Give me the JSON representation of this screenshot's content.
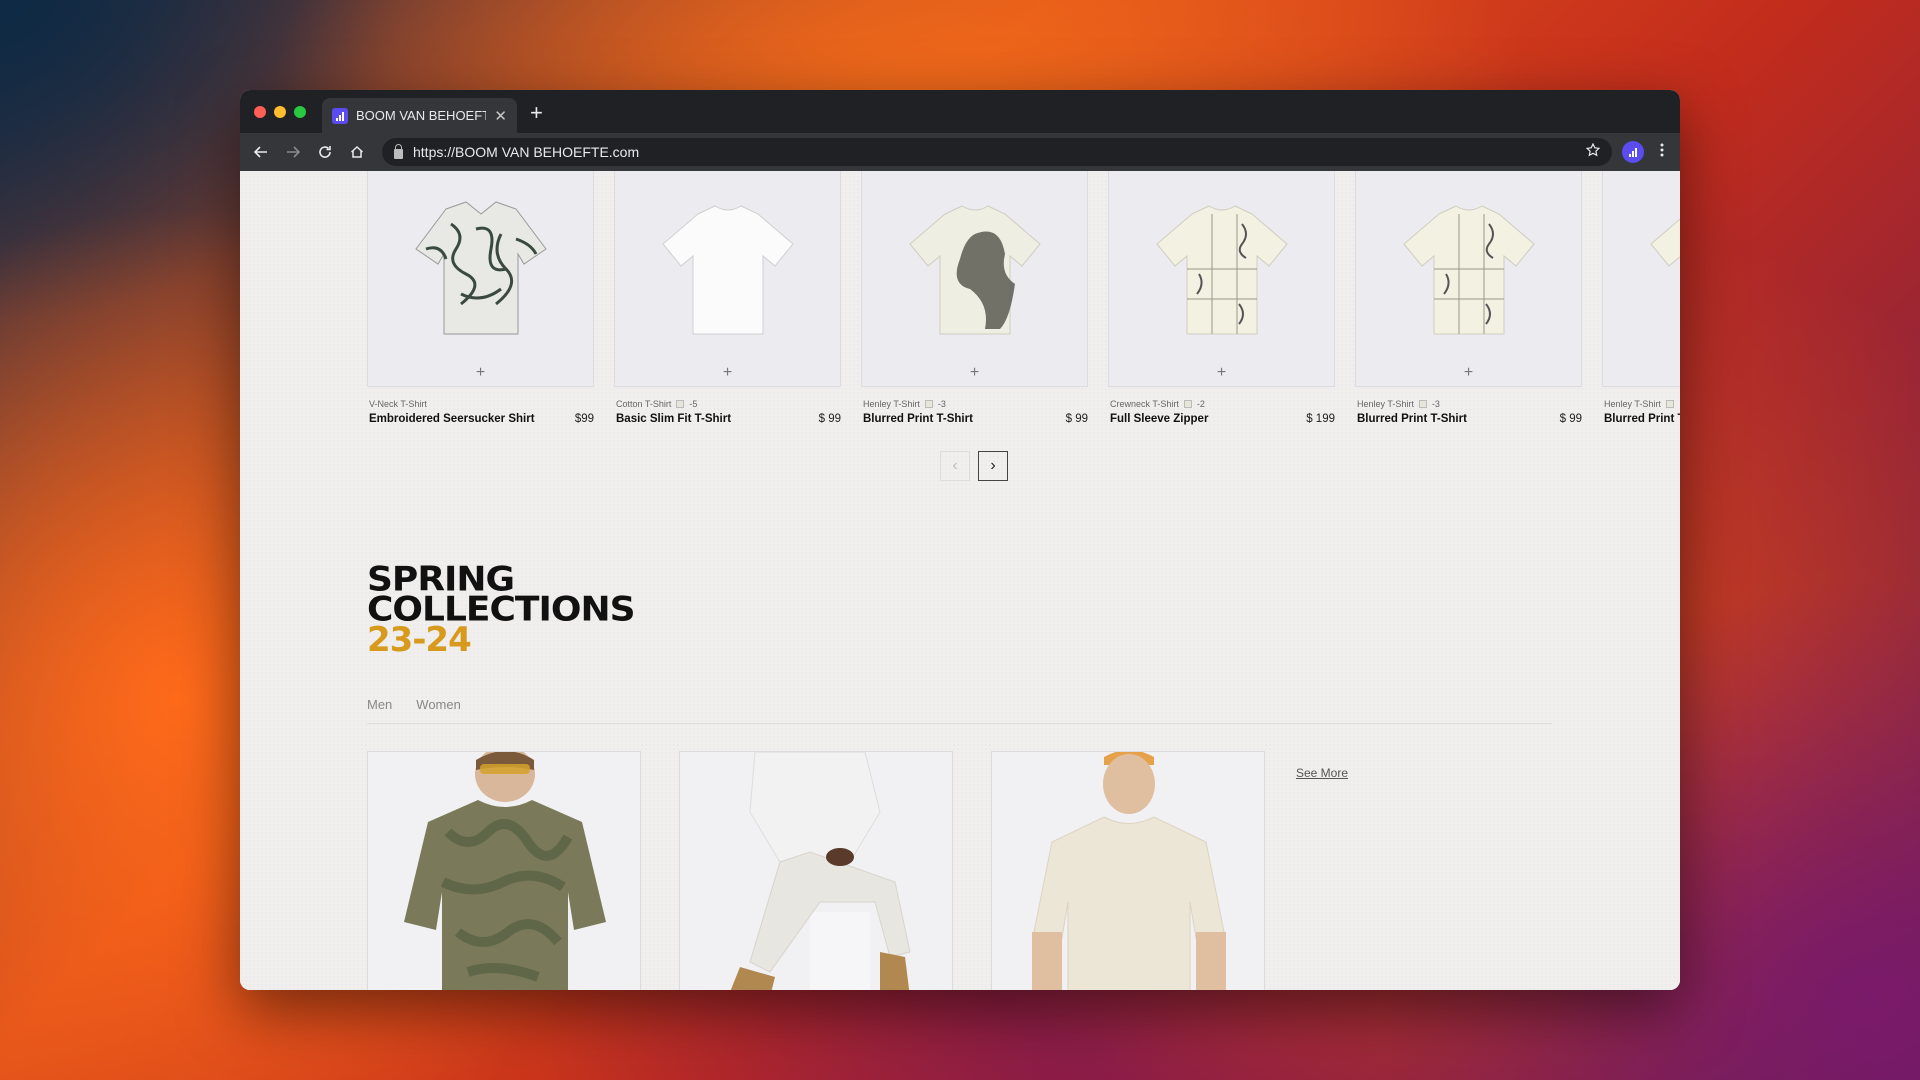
{
  "browser": {
    "tab_title": "BOOM VAN BEHOEFTE",
    "url": "https://BOOM VAN BEHOEFTE.com",
    "close_glyph": "✕",
    "newtab_glyph": "+"
  },
  "products": [
    {
      "category": "V-Neck T-Shirt",
      "swatch_count": "",
      "name": "Embroidered Seersucker Shirt",
      "price": "$99"
    },
    {
      "category": "Cotton T-Shirt",
      "swatch_count": "-5",
      "name": "Basic Slim Fit T-Shirt",
      "price": "$ 99"
    },
    {
      "category": "Henley T-Shirt",
      "swatch_count": "-3",
      "name": "Blurred Print T-Shirt",
      "price": "$ 99"
    },
    {
      "category": "Crewneck T-Shirt",
      "swatch_count": "-2",
      "name": "Full Sleeve Zipper",
      "price": "$ 199"
    },
    {
      "category": "Henley T-Shirt",
      "swatch_count": "-3",
      "name": "Blurred Print T-Shirt",
      "price": "$ 99"
    },
    {
      "category": "Henley T-Shirt",
      "swatch_count": "",
      "name": "Blurred Print T",
      "price": ""
    }
  ],
  "pager": {
    "prev": "‹",
    "next": "›"
  },
  "section": {
    "title_line1": "SPRING",
    "title_line2": "COLLECTIONS",
    "title_line3": "23-24",
    "tabs": [
      "Men",
      "Women"
    ],
    "see_more": "See More"
  },
  "colors": {
    "accent": "#d79a1c",
    "favicon": "#5b4cf0"
  }
}
